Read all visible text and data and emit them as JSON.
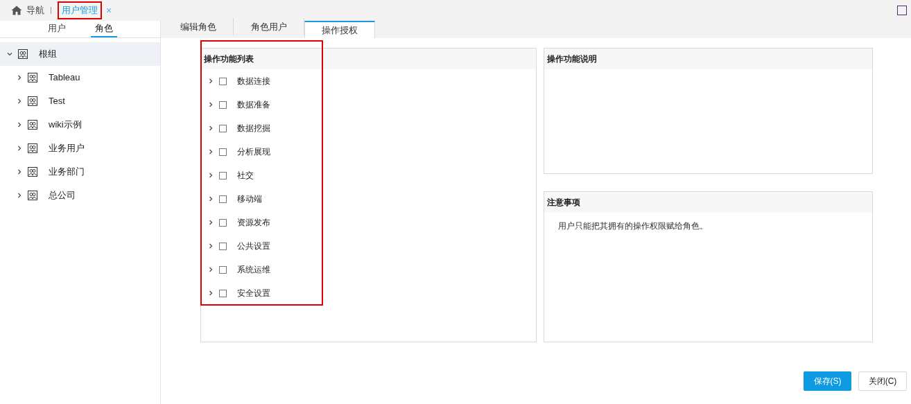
{
  "top_bar": {
    "home": {
      "label": "导航"
    },
    "tabs": [
      {
        "label": "用户管理",
        "selected": true,
        "close": "×"
      }
    ]
  },
  "sidebar": {
    "tabs": [
      {
        "label": "用户",
        "selected": false
      },
      {
        "label": "角色",
        "selected": true
      }
    ],
    "tree": [
      {
        "label": "根组",
        "expanded": true,
        "selected": true,
        "children": [
          {
            "label": "Tableau",
            "expanded": false,
            "selected": false
          },
          {
            "label": "Test",
            "expanded": false,
            "selected": false
          },
          {
            "label": "wiki示例",
            "expanded": false,
            "selected": false
          },
          {
            "label": "业务用户",
            "expanded": false,
            "selected": false
          },
          {
            "label": "业务部门",
            "expanded": false,
            "selected": false
          },
          {
            "label": "总公司",
            "expanded": false,
            "selected": false
          }
        ]
      }
    ]
  },
  "main_tabs": [
    {
      "label": "编辑角色",
      "selected": false
    },
    {
      "label": "角色用户",
      "selected": false
    },
    {
      "label": "操作授权",
      "selected": true
    }
  ],
  "function_list": {
    "title": "操作功能列表",
    "items": [
      {
        "label": "数据连接",
        "checked": false
      },
      {
        "label": "数据准备",
        "checked": false
      },
      {
        "label": "数据挖掘",
        "checked": false
      },
      {
        "label": "分析展现",
        "checked": false
      },
      {
        "label": "社交",
        "checked": false
      },
      {
        "label": "移动端",
        "checked": false
      },
      {
        "label": "资源发布",
        "checked": false
      },
      {
        "label": "公共设置",
        "checked": false
      },
      {
        "label": "系统运维",
        "checked": false
      },
      {
        "label": "安全设置",
        "checked": false
      }
    ]
  },
  "description_panel": {
    "title": "操作功能说明"
  },
  "notes_panel": {
    "title": "注意事项",
    "text": "用户只能把其拥有的操作权限赋给角色。"
  },
  "buttons": [
    {
      "label": "保存(S)",
      "kind": "primary"
    },
    {
      "label": "关闭(C)",
      "kind": "secondary"
    }
  ]
}
